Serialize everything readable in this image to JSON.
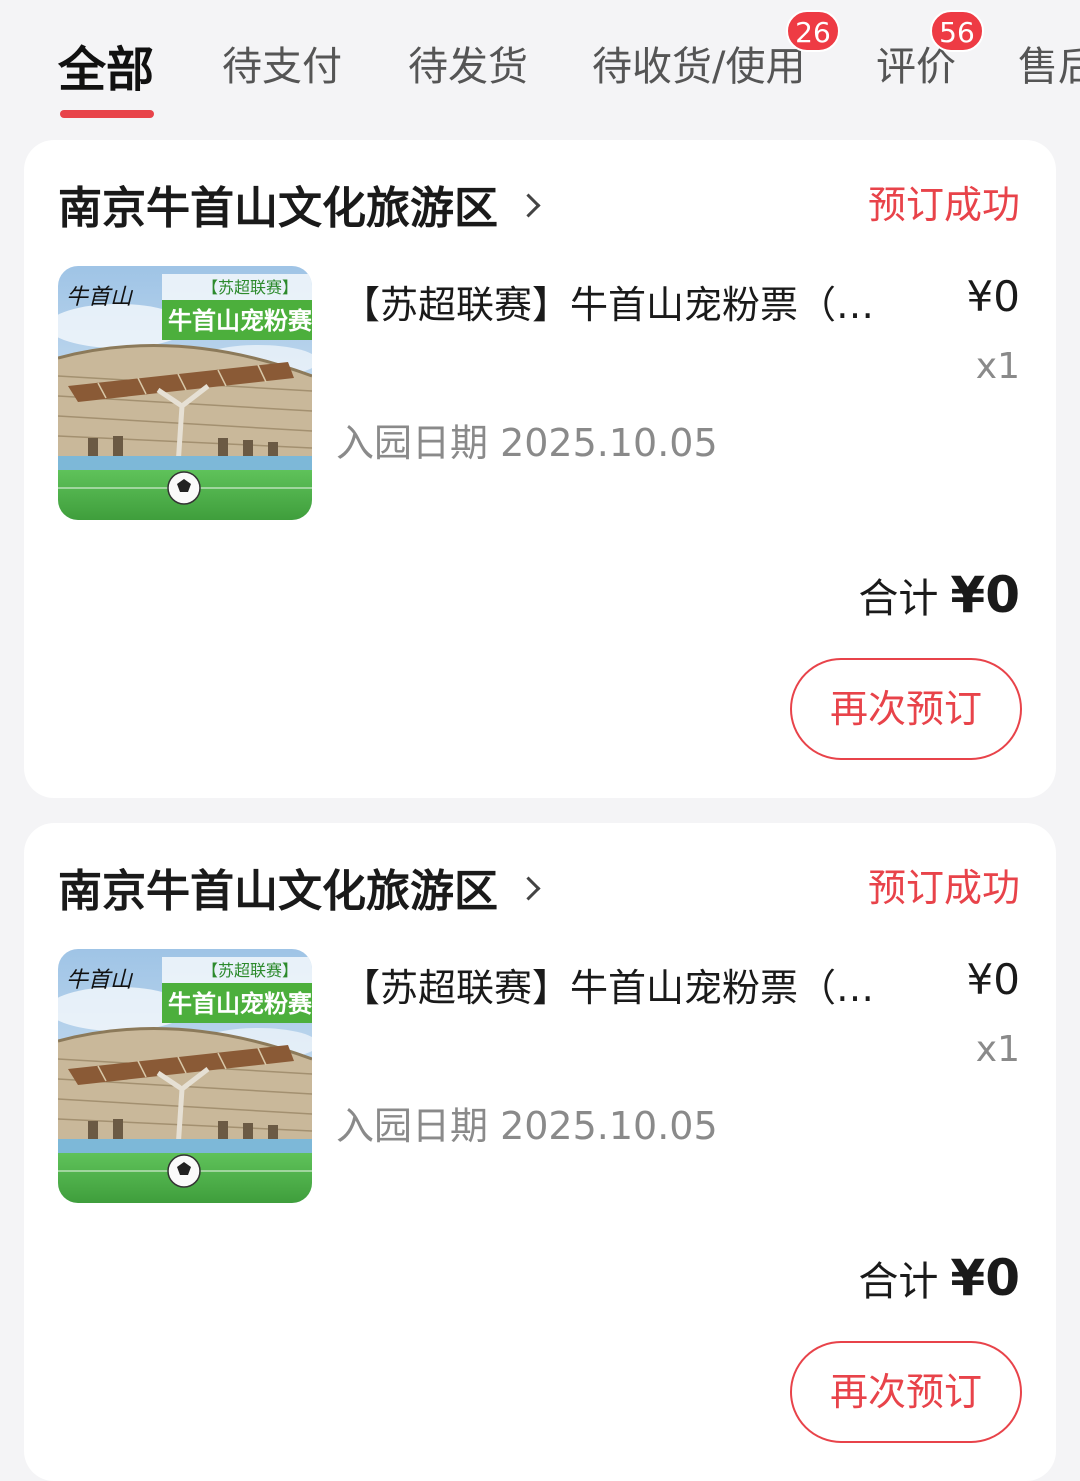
{
  "tabs": [
    {
      "label": "全部",
      "active": true
    },
    {
      "label": "待支付"
    },
    {
      "label": "待发货"
    },
    {
      "label": "待收货/使用",
      "badge": "26"
    },
    {
      "label": "评价",
      "badge": "56"
    },
    {
      "label": "售后"
    }
  ],
  "accent_color": "#e8434a",
  "orders": [
    {
      "shop_name": "南京牛首山文化旅游区",
      "status": "预订成功",
      "thumbnail": {
        "logo_text": "牛首山",
        "banner_top": "【苏超联赛】",
        "banner_main": "牛首山宠粉赛"
      },
      "product_title": "【苏超联赛】牛首山宠粉票（…",
      "price": "¥0",
      "quantity": "x1",
      "visit_date": "入园日期 2025.10.05",
      "total_label": "合计",
      "total_value": "¥0",
      "rebook_label": "再次预订"
    },
    {
      "shop_name": "南京牛首山文化旅游区",
      "status": "预订成功",
      "thumbnail": {
        "logo_text": "牛首山",
        "banner_top": "【苏超联赛】",
        "banner_main": "牛首山宠粉赛"
      },
      "product_title": "【苏超联赛】牛首山宠粉票（…",
      "price": "¥0",
      "quantity": "x1",
      "visit_date": "入园日期 2025.10.05",
      "total_label": "合计",
      "total_value": "¥0",
      "rebook_label": "再次预订"
    }
  ]
}
